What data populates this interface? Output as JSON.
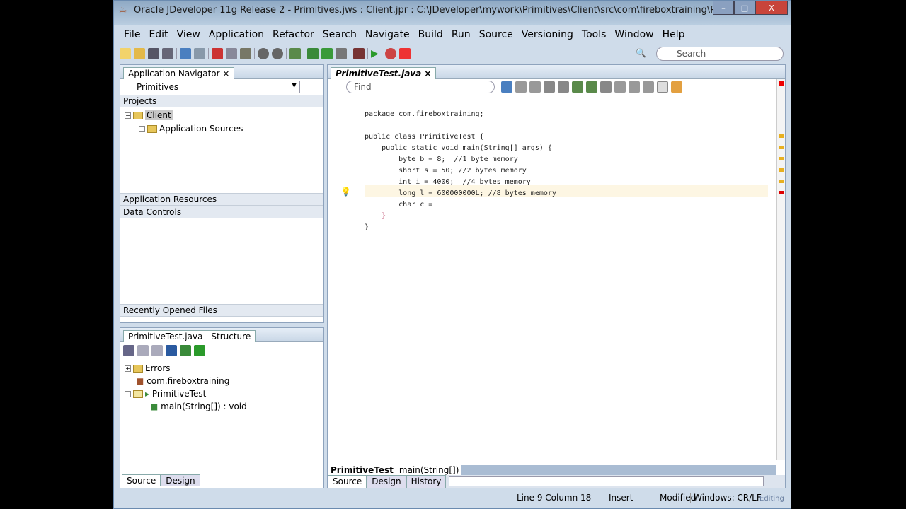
{
  "window": {
    "title": "Oracle JDeveloper 11g Release 2 - Primitives.jws : Client.jpr : C:\\JDeveloper\\mywork\\Primitives\\Client\\src\\com\\fireboxtraining\\Pri...",
    "minimize": "–",
    "maximize": "□",
    "close": "X"
  },
  "menu": [
    "File",
    "Edit",
    "View",
    "Application",
    "Refactor",
    "Search",
    "Navigate",
    "Build",
    "Run",
    "Source",
    "Versioning",
    "Tools",
    "Window",
    "Help"
  ],
  "search": {
    "placeholder": "Search"
  },
  "navigator": {
    "tab": "Application Navigator",
    "close": "×",
    "app_select": "Primitives",
    "projects": "Projects",
    "client": "Client",
    "app_sources": "Application Sources",
    "app_resources": "Application Resources",
    "data_controls": "Data Controls",
    "recent": "Recently Opened Files"
  },
  "structure": {
    "tab": "PrimitiveTest.java - Structure",
    "items": [
      "Errors",
      "com.fireboxtraining",
      "PrimitiveTest",
      "main(String[]) : void"
    ],
    "tabs": [
      "Source",
      "Design"
    ]
  },
  "editor": {
    "tab": "PrimitiveTest.java",
    "find_placeholder": "Find",
    "lines": [
      "package com.fireboxtraining;",
      "",
      "public class PrimitiveTest {",
      "    public static void main(String[] args) {",
      "        byte b = 8;  //1 byte memory",
      "        short s = 50; //2 bytes memory",
      "        int i = 4000;  //4 bytes memory",
      "        long l = 600000000L; //8 bytes memory",
      "        char c = ",
      "    }",
      "}"
    ],
    "breadcrumb": [
      "PrimitiveTest",
      "main(String[])"
    ],
    "bottom_tabs": [
      "Source",
      "Design",
      "History"
    ]
  },
  "status": {
    "position": "Line 9 Column 18",
    "mode": "Insert",
    "modified": "Modified",
    "eol": "Windows: CR/LF",
    "state": "Editing"
  }
}
